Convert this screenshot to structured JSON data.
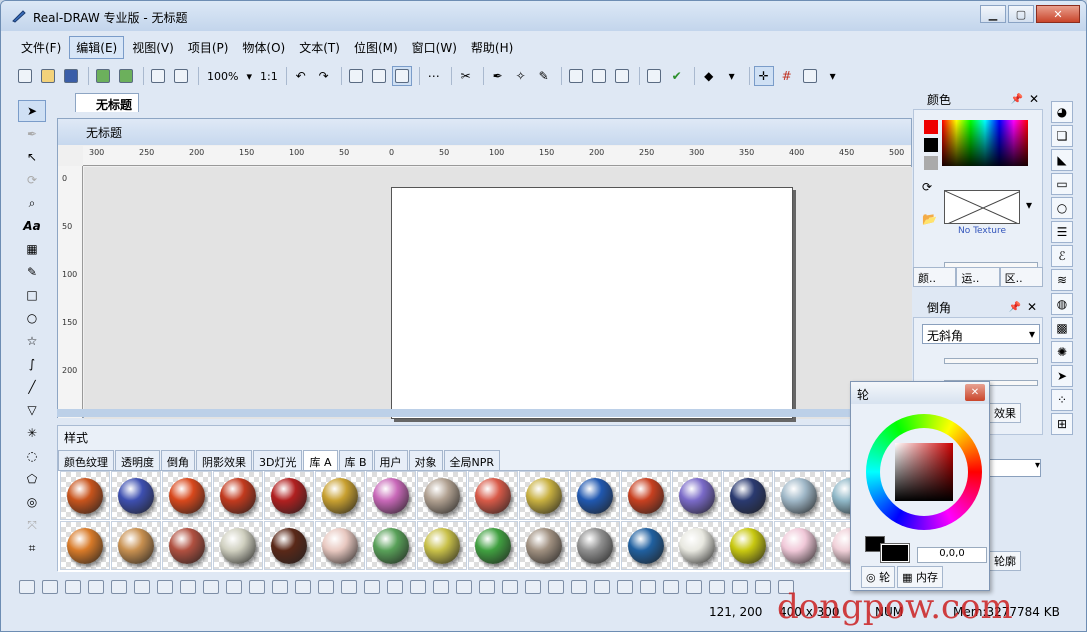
{
  "window": {
    "title": "Real-DRAW 专业版 - 无标题"
  },
  "menu": [
    "文件(F)",
    "编辑(E)",
    "视图(V)",
    "项目(P)",
    "物体(O)",
    "文本(T)",
    "位图(M)",
    "窗口(W)",
    "帮助(H)"
  ],
  "menu_active_index": 1,
  "toolbar": {
    "zoom": "100%",
    "ratio": "1:1"
  },
  "document": {
    "tab": "无标题",
    "window_title": "无标题"
  },
  "ruler": {
    "h_labels": [
      "300",
      "250",
      "200",
      "150",
      "100",
      "50",
      "0",
      "50",
      "100",
      "150",
      "200",
      "250",
      "300",
      "350",
      "400",
      "450",
      "500"
    ],
    "v_labels": [
      "0",
      "50",
      "100",
      "150",
      "200"
    ]
  },
  "panels": {
    "color": {
      "title": "颜色",
      "texture_label": "No Texture",
      "tabs": [
        "颜..",
        "运..",
        "区.."
      ]
    },
    "bevel": {
      "title": "倒角",
      "select_value": "无斜角"
    },
    "effects_tab": "效果",
    "outline_tab": "轮廓"
  },
  "styles": {
    "title": "样式",
    "tabs": [
      "颜色纹理",
      "透明度",
      "倒角",
      "阴影效果",
      "3D灯光",
      "库 A",
      "库 B",
      "用户",
      "对象",
      "全局NPR"
    ],
    "active_tab_index": 5,
    "row1_colors": [
      "#c8541c",
      "#3d4fb0",
      "#d8481c",
      "#c23a1e",
      "#b02020",
      "#c8a030",
      "#c868b8",
      "#b0a090",
      "#d85a48",
      "#c8b040",
      "#2058b0",
      "#c84020",
      "#7a6ac8",
      "#2a3a70",
      "#a0b8c8",
      "#90b8c8"
    ],
    "row2_colors": [
      "#d87a28",
      "#c89050",
      "#b05040",
      "#d0d0c0",
      "#5a2818",
      "#e8c8c0",
      "#58a058",
      "#c8c048",
      "#40a040",
      "#a09080",
      "#909090",
      "#2060a0",
      "#e8e8e0",
      "#c8c810",
      "#f0c8d8",
      "#f0d0d8"
    ]
  },
  "wheel_panel": {
    "title": "轮",
    "value": "0,0,0",
    "tabs": [
      "轮",
      "内存"
    ]
  },
  "status": {
    "coords": "121, 200",
    "size": "400 x 300",
    "num": "NUM",
    "mem": "Mem:3277784 KB"
  },
  "watermark": "dongpow.com",
  "colors": {
    "accent": "#7a9cc9",
    "title_bg": "#dce8f6"
  }
}
